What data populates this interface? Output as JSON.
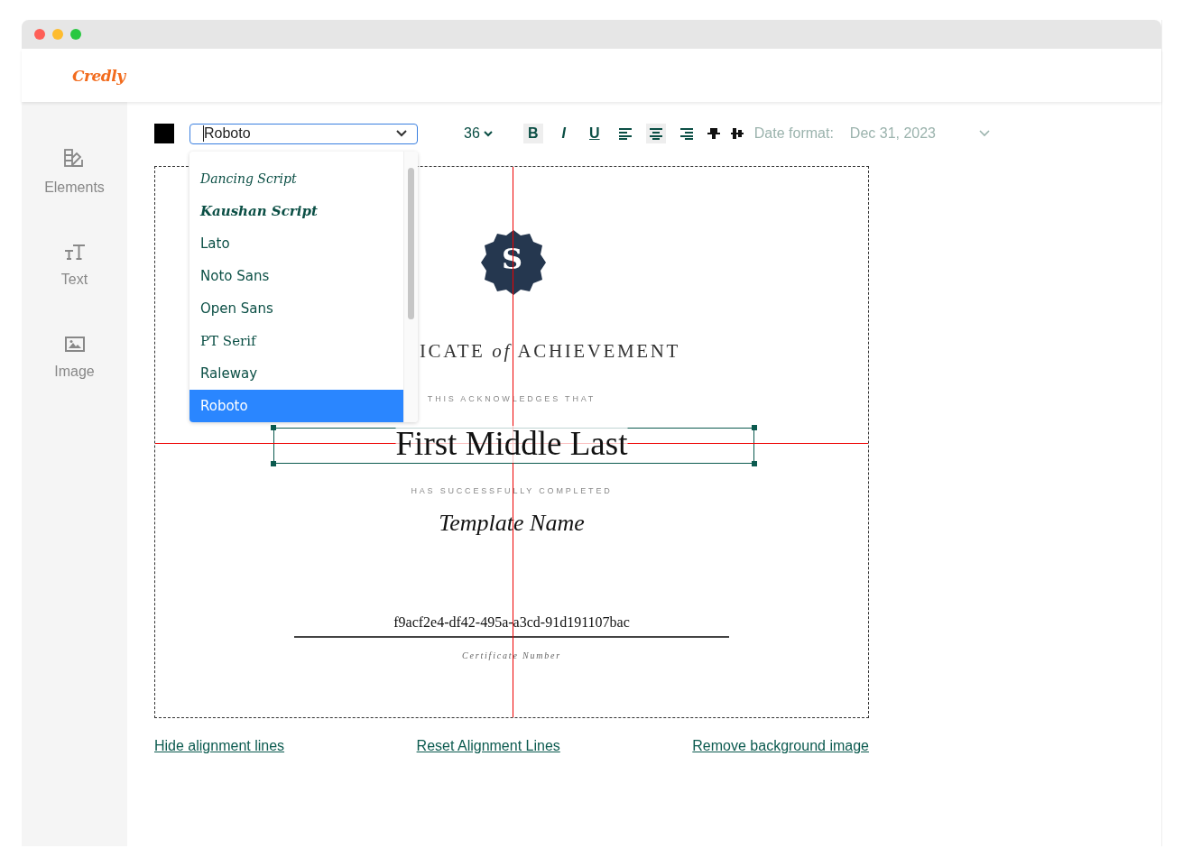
{
  "app": {
    "logo": "Credly"
  },
  "sidebar": {
    "items": [
      {
        "label": "Elements",
        "kind": "elements"
      },
      {
        "label": "Text",
        "kind": "text"
      },
      {
        "label": "Image",
        "kind": "image"
      }
    ]
  },
  "toolbar": {
    "font_select": {
      "value": "Roboto"
    },
    "font_size": "36",
    "format_buttons": [
      {
        "kind": "bold",
        "label": "B",
        "selected": true
      },
      {
        "kind": "italic",
        "label": "I",
        "selected": false
      },
      {
        "kind": "underline",
        "label": "U",
        "selected": false
      },
      {
        "kind": "align-left",
        "selected": false
      },
      {
        "kind": "align-center",
        "selected": true
      },
      {
        "kind": "align-right",
        "selected": false
      },
      {
        "kind": "align-middle",
        "selected": false
      },
      {
        "kind": "distribute",
        "selected": false
      }
    ],
    "date_format": {
      "label": "Date format:",
      "value": "Dec 31, 2023"
    }
  },
  "font_dropdown": {
    "options": [
      {
        "label": "Dancing Script",
        "kind": "script",
        "selected": false
      },
      {
        "label": "Kaushan Script",
        "kind": "script-bold",
        "selected": false
      },
      {
        "label": "Lato",
        "kind": "sans",
        "selected": false
      },
      {
        "label": "Noto Sans",
        "kind": "sans",
        "selected": false
      },
      {
        "label": "Open Sans",
        "kind": "sans",
        "selected": false
      },
      {
        "label": "PT Serif",
        "kind": "serif",
        "selected": false
      },
      {
        "label": "Raleway",
        "kind": "sans",
        "selected": false
      },
      {
        "label": "Roboto",
        "kind": "sans",
        "selected": true
      }
    ]
  },
  "certificate": {
    "badge_letter": "S",
    "title": "ICATE *of* ACHIEVEMENT",
    "intro": "THIS ACKNOWLEDGES THAT",
    "recipient": "First Middle Last",
    "completed": "HAS SUCCESSFULLY COMPLETED",
    "template_name": "Template Name",
    "certificate_number": "f9acf2e4-df42-495a-a3cd-91d191107bac",
    "number_caption": "Certificate Number",
    "alignment_lines": true
  },
  "links": [
    "Hide alignment lines",
    "Reset Alignment Lines",
    "Remove background image"
  ]
}
